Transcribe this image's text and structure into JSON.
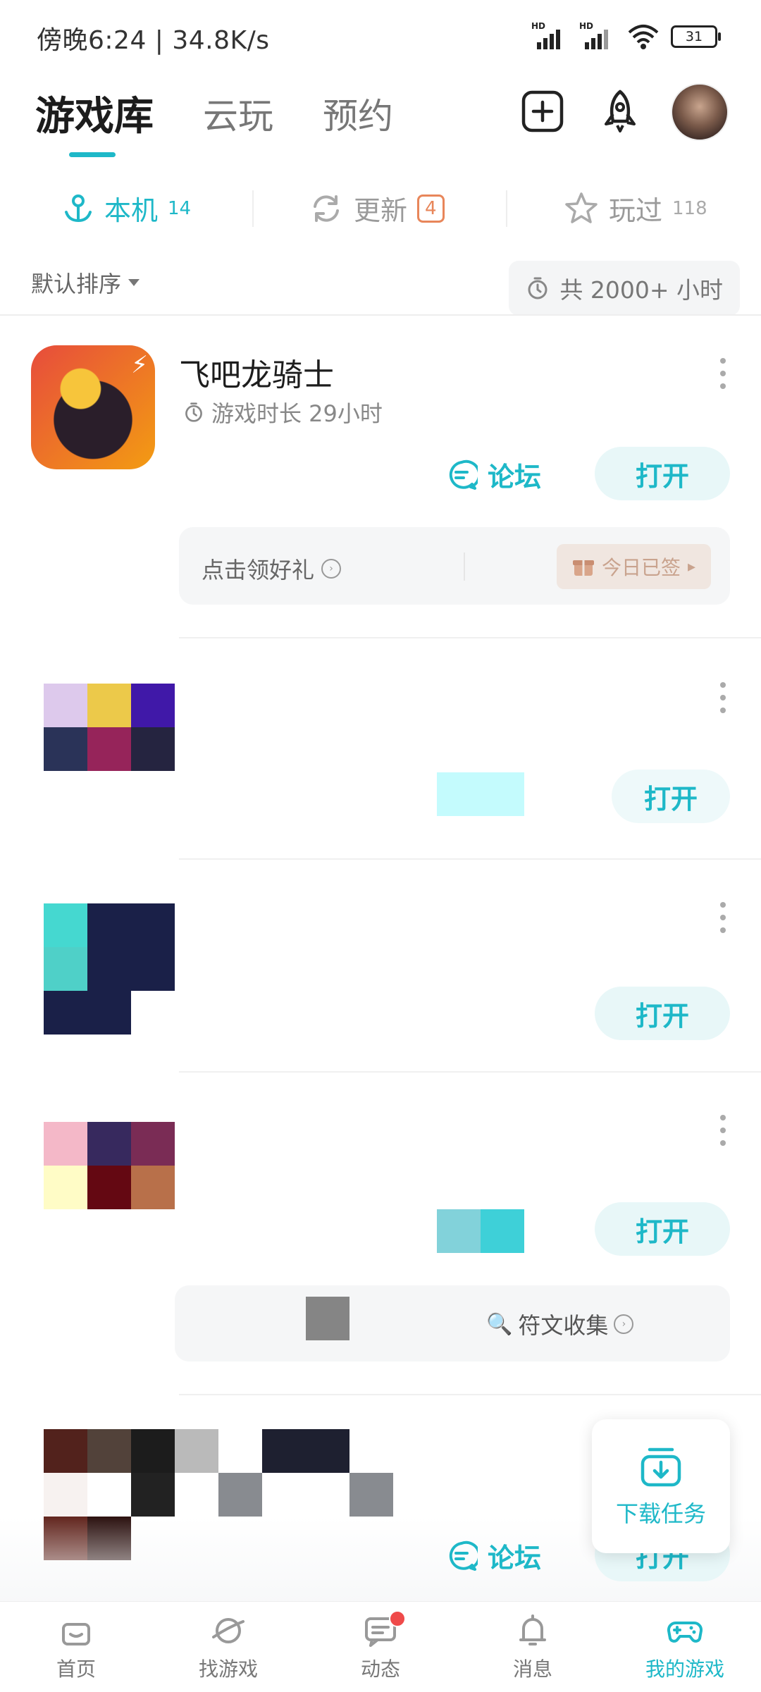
{
  "status_bar": {
    "time_speed": "傍晚6:24 | 34.8K/s",
    "signal_label": "HD",
    "battery": "31"
  },
  "header": {
    "tabs": [
      {
        "label": "游戏库"
      },
      {
        "label": "云玩"
      },
      {
        "label": "预约"
      }
    ]
  },
  "subtabs": [
    {
      "label": "本机",
      "count": "14"
    },
    {
      "label": "更新",
      "count": "4"
    },
    {
      "label": "玩过",
      "count": "118"
    }
  ],
  "sort": {
    "label": "默认排序",
    "total": "共 2000+ 小时"
  },
  "games": [
    {
      "title": "飞吧龙骑士",
      "play_time": "游戏时长 29小时",
      "forum_label": "论坛",
      "open_label": "打开",
      "gift_label": "点击领好礼",
      "signed_label": "今日已签"
    },
    {
      "open_label": "打开"
    },
    {
      "open_label": "打开"
    },
    {
      "open_label": "打开",
      "rune_label": "符文收集"
    },
    {
      "forum_label": "论坛",
      "open_label": "打开"
    }
  ],
  "fab": {
    "label": "下载任务"
  },
  "bottom_nav": [
    {
      "label": "首页"
    },
    {
      "label": "找游戏"
    },
    {
      "label": "动态"
    },
    {
      "label": "消息"
    },
    {
      "label": "我的游戏"
    }
  ],
  "colors": {
    "accent": "#1eb8c8",
    "badge": "#e8865a",
    "notify": "#ef4a4a"
  }
}
